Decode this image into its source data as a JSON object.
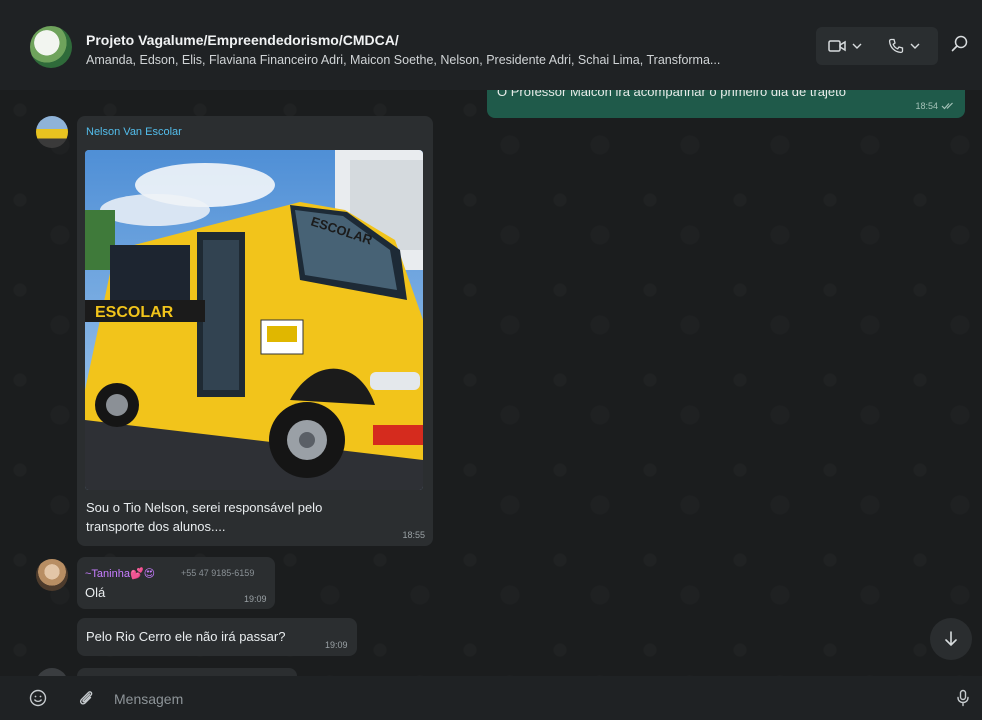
{
  "header": {
    "title": "Projeto Vagalume/Empreendedorismo/CMDCA/",
    "members": "Amanda, Edson, Elis, Flaviana Financeiro Adri, Maicon Soethe, Nelson, Presidente Adri, Schai Lima, Transforma..."
  },
  "icons": {
    "video": "video-camera-icon",
    "phone": "phone-icon",
    "search": "search-icon",
    "emoji": "emoji-icon",
    "attach": "paperclip-icon",
    "mic": "microphone-icon",
    "scroll": "arrow-down-icon"
  },
  "messages": {
    "outgoing_top": {
      "text": "O Professor Maicon irá acompanhar o primeiro dia de trajeto",
      "time": "18:54"
    },
    "nelson": {
      "sender": "Nelson Van Escolar",
      "caption_line1": "Sou o Tio Nelson, serei responsável pelo",
      "caption_line2": "transporte dos alunos....",
      "time": "18:55",
      "image_text_front": "ESCOLAR",
      "image_text_side": "ESCOLAR"
    },
    "taninha1": {
      "sender": "~Taninha💕😍",
      "phone": "+55 47 9185-6159",
      "text": "Olá",
      "time": "19:09"
    },
    "taninha2": {
      "text": "Pelo Rio Cerro ele não irá passar?",
      "time": "19:09"
    }
  },
  "composer": {
    "placeholder": "Mensagem"
  },
  "colors": {
    "accent_sender_nelson": "#53bdeb",
    "accent_sender_taninha": "#c77dff",
    "outgoing_bubble": "#1f5a4a",
    "incoming_bubble": "#2b2e30"
  }
}
